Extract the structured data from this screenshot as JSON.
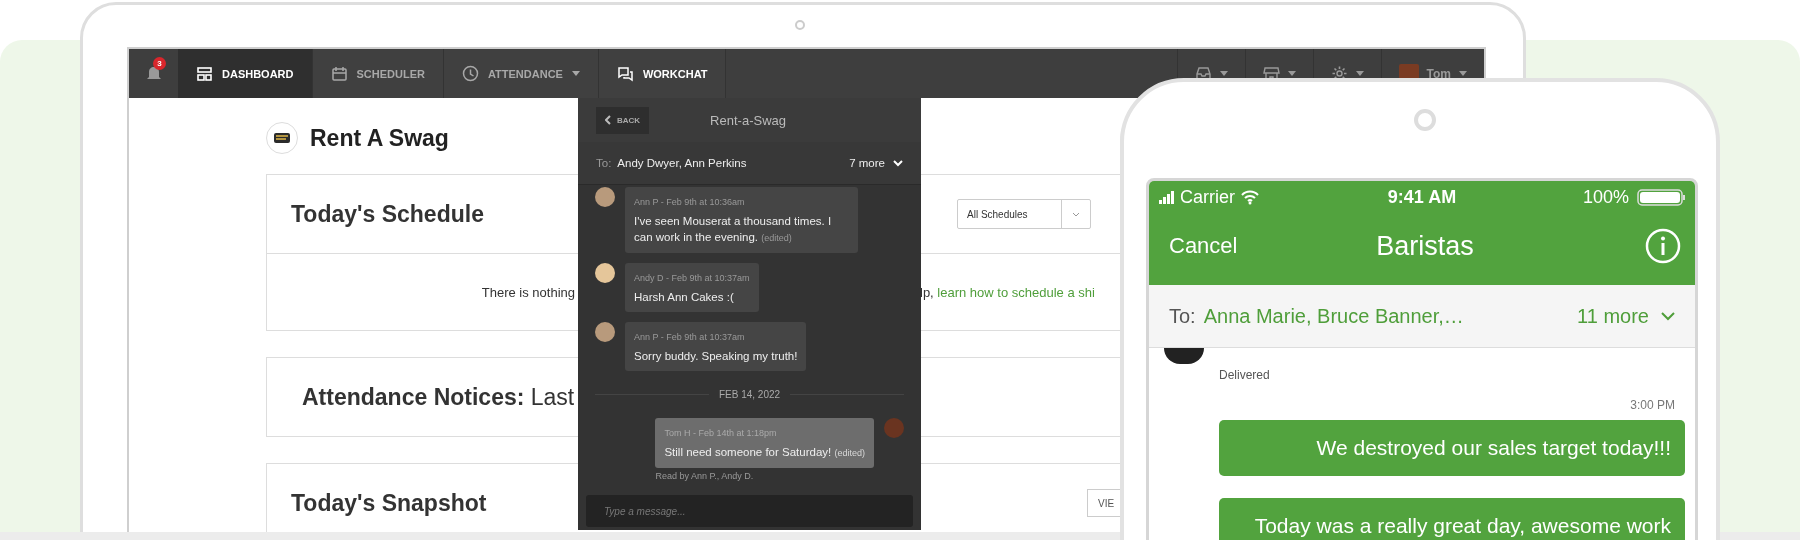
{
  "laptop": {
    "nav": {
      "notification_count": "3",
      "tabs": [
        {
          "label": "DASHBOARD",
          "selected": true,
          "open": false,
          "dropdown": false
        },
        {
          "label": "SCHEDULER",
          "selected": false,
          "open": false,
          "dropdown": false
        },
        {
          "label": "ATTENDANCE",
          "selected": false,
          "open": false,
          "dropdown": true
        },
        {
          "label": "WORKCHAT",
          "selected": false,
          "open": true,
          "dropdown": false
        }
      ],
      "menus": [
        {
          "kind": "inbox"
        },
        {
          "kind": "store"
        },
        {
          "kind": "gear"
        },
        {
          "kind": "user",
          "label": "Tom"
        }
      ]
    },
    "company": "Rent A Swag",
    "schedule_card": {
      "title": "Today's Schedule",
      "filter": "All Schedules",
      "empty_text": "There is nothing",
      "empty_text_end": "lp,",
      "link": "learn how to schedule a shi"
    },
    "attendance_card": {
      "title": "**Attendance Notices:** Last"
    },
    "snapshot_card": {
      "title": "Today's Snapshot",
      "button": "VIE"
    },
    "workchat": {
      "back": "BACK",
      "title": "Rent-a-Swag",
      "to_label": "To:",
      "recipients": "Andy Dwyer, Ann Perkins",
      "more": "7 more",
      "items": [
        {
          "kind": "message",
          "mine": false,
          "author": "Ann P - Feb 9th at 10:36am",
          "text": "I've seen Mouserat a thousand times. I can work in the evening.",
          "edited": "(edited)"
        },
        {
          "kind": "message",
          "mine": false,
          "author": "Andy D - Feb 9th at 10:37am",
          "text": "Harsh Ann Cakes :("
        },
        {
          "kind": "message",
          "mine": false,
          "author": "Ann P - Feb 9th at 10:37am",
          "text": "Sorry buddy. Speaking my truth!"
        },
        {
          "kind": "divider",
          "text": "FEB 14, 2022"
        },
        {
          "kind": "message",
          "mine": true,
          "author": "Tom H - Feb 14th at 1:18pm",
          "text": "Still need someone for Saturday!",
          "edited": "(edited)",
          "read": "Read by Ann P., Andy D."
        }
      ],
      "placeholder": "Type a message..."
    }
  },
  "phone": {
    "status": {
      "carrier": "Carrier",
      "time": "9:41 AM",
      "battery": "100%"
    },
    "nav": {
      "cancel": "Cancel",
      "title": "Baristas"
    },
    "to": {
      "label": "To:",
      "recipients": "Anna Marie, Bruce Banner,…",
      "more": "11 more"
    },
    "delivered": "Delivered",
    "time": "3:00 PM",
    "bubbles": [
      "We destroyed our sales target today!!!",
      "Today was a really great day, awesome work"
    ]
  }
}
